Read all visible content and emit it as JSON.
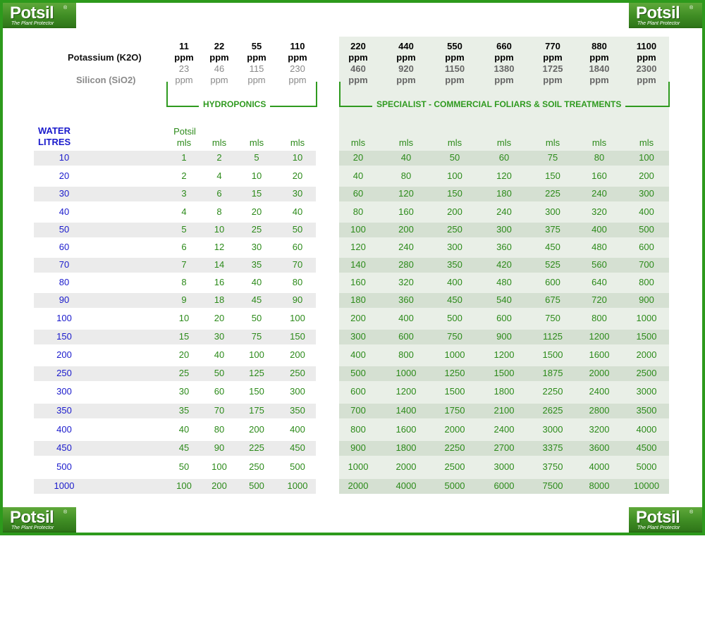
{
  "logo": {
    "word": "Potsil",
    "tm": "®",
    "tagline": "The Plant Protector"
  },
  "labels": {
    "potassium": "Potassium (K2O)",
    "silicon": "Silicon (SiO2)",
    "hydroponics": "HYDROPONICS",
    "specialist": "SPECIALIST - COMMERCIAL FOLIARS & SOIL TREATMENTS",
    "water_line1": "WATER",
    "water_line2": "LITRES",
    "potsil": "Potsil",
    "mls": "mls",
    "ppm": "ppm"
  },
  "columns": [
    {
      "k": "11",
      "si": "23",
      "group": "hydro"
    },
    {
      "k": "22",
      "si": "46",
      "group": "hydro"
    },
    {
      "k": "55",
      "si": "115",
      "group": "hydro"
    },
    {
      "k": "110",
      "si": "230",
      "group": "hydro"
    },
    {
      "k": "220",
      "si": "460",
      "group": "spec"
    },
    {
      "k": "440",
      "si": "920",
      "group": "spec"
    },
    {
      "k": "550",
      "si": "1150",
      "group": "spec"
    },
    {
      "k": "660",
      "si": "1380",
      "group": "spec"
    },
    {
      "k": "770",
      "si": "1725",
      "group": "spec"
    },
    {
      "k": "880",
      "si": "1840",
      "group": "spec"
    },
    {
      "k": "1100",
      "si": "2300",
      "group": "spec"
    }
  ],
  "rows": [
    {
      "litres": "10",
      "mls": [
        "1",
        "2",
        "5",
        "10",
        "20",
        "40",
        "50",
        "60",
        "75",
        "80",
        "100"
      ]
    },
    {
      "litres": "20",
      "mls": [
        "2",
        "4",
        "10",
        "20",
        "40",
        "80",
        "100",
        "120",
        "150",
        "160",
        "200"
      ]
    },
    {
      "litres": "30",
      "mls": [
        "3",
        "6",
        "15",
        "30",
        "60",
        "120",
        "150",
        "180",
        "225",
        "240",
        "300"
      ]
    },
    {
      "litres": "40",
      "mls": [
        "4",
        "8",
        "20",
        "40",
        "80",
        "160",
        "200",
        "240",
        "300",
        "320",
        "400"
      ]
    },
    {
      "litres": "50",
      "mls": [
        "5",
        "10",
        "25",
        "50",
        "100",
        "200",
        "250",
        "300",
        "375",
        "400",
        "500"
      ]
    },
    {
      "litres": "60",
      "mls": [
        "6",
        "12",
        "30",
        "60",
        "120",
        "240",
        "300",
        "360",
        "450",
        "480",
        "600"
      ]
    },
    {
      "litres": "70",
      "mls": [
        "7",
        "14",
        "35",
        "70",
        "140",
        "280",
        "350",
        "420",
        "525",
        "560",
        "700"
      ]
    },
    {
      "litres": "80",
      "mls": [
        "8",
        "16",
        "40",
        "80",
        "160",
        "320",
        "400",
        "480",
        "600",
        "640",
        "800"
      ]
    },
    {
      "litres": "90",
      "mls": [
        "9",
        "18",
        "45",
        "90",
        "180",
        "360",
        "450",
        "540",
        "675",
        "720",
        "900"
      ]
    },
    {
      "litres": "100",
      "mls": [
        "10",
        "20",
        "50",
        "100",
        "200",
        "400",
        "500",
        "600",
        "750",
        "800",
        "1000"
      ]
    },
    {
      "litres": "150",
      "mls": [
        "15",
        "30",
        "75",
        "150",
        "300",
        "600",
        "750",
        "900",
        "1125",
        "1200",
        "1500"
      ]
    },
    {
      "litres": "200",
      "mls": [
        "20",
        "40",
        "100",
        "200",
        "400",
        "800",
        "1000",
        "1200",
        "1500",
        "1600",
        "2000"
      ]
    },
    {
      "litres": "250",
      "mls": [
        "25",
        "50",
        "125",
        "250",
        "500",
        "1000",
        "1250",
        "1500",
        "1875",
        "2000",
        "2500"
      ]
    },
    {
      "litres": "300",
      "mls": [
        "30",
        "60",
        "150",
        "300",
        "600",
        "1200",
        "1500",
        "1800",
        "2250",
        "2400",
        "3000"
      ]
    },
    {
      "litres": "350",
      "mls": [
        "35",
        "70",
        "175",
        "350",
        "700",
        "1400",
        "1750",
        "2100",
        "2625",
        "2800",
        "3500"
      ]
    },
    {
      "litres": "400",
      "mls": [
        "40",
        "80",
        "200",
        "400",
        "800",
        "1600",
        "2000",
        "2400",
        "3000",
        "3200",
        "4000"
      ]
    },
    {
      "litres": "450",
      "mls": [
        "45",
        "90",
        "225",
        "450",
        "900",
        "1800",
        "2250",
        "2700",
        "3375",
        "3600",
        "4500"
      ]
    },
    {
      "litres": "500",
      "mls": [
        "50",
        "100",
        "250",
        "500",
        "1000",
        "2000",
        "2500",
        "3000",
        "3750",
        "4000",
        "5000"
      ]
    },
    {
      "litres": "1000",
      "mls": [
        "100",
        "200",
        "500",
        "1000",
        "2000",
        "4000",
        "5000",
        "6000",
        "7500",
        "8000",
        "10000"
      ]
    }
  ],
  "colors": {
    "border": "#2d9a1c",
    "text_green": "#2c8a1a",
    "text_blue": "#1a1acc",
    "panel": "#e9efe7"
  }
}
